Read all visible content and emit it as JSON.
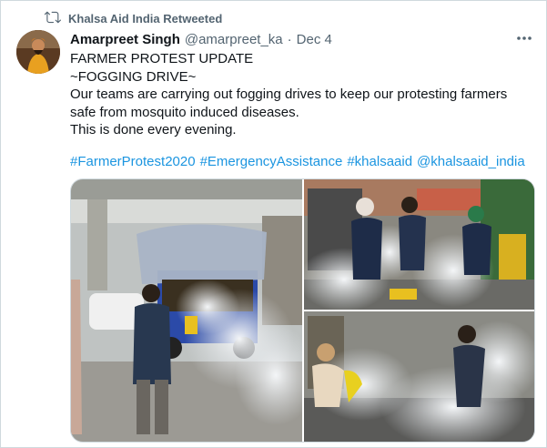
{
  "retweet": {
    "label": "Khalsa Aid India Retweeted",
    "icon": "retweet-icon"
  },
  "tweet": {
    "author_name": "Amarpreet Singh",
    "author_handle": "@amarpreet_ka",
    "separator": "·",
    "date": "Dec 4",
    "more_icon": "more-icon",
    "lines": [
      "FARMER PROTEST UPDATE",
      "~FOGGING DRIVE~",
      "Our teams are carrying out fogging drives to keep our protesting farmers",
      "safe from mosquito induced diseases.",
      "This is done every evening."
    ],
    "hashtags": [
      "#FarmerProtest2020",
      "#EmergencyAssistance",
      "#khalsaaid",
      "@khalsaaid_india"
    ]
  },
  "colors": {
    "link": "#1b95e0",
    "muted": "#536471",
    "text": "#0f1419"
  }
}
